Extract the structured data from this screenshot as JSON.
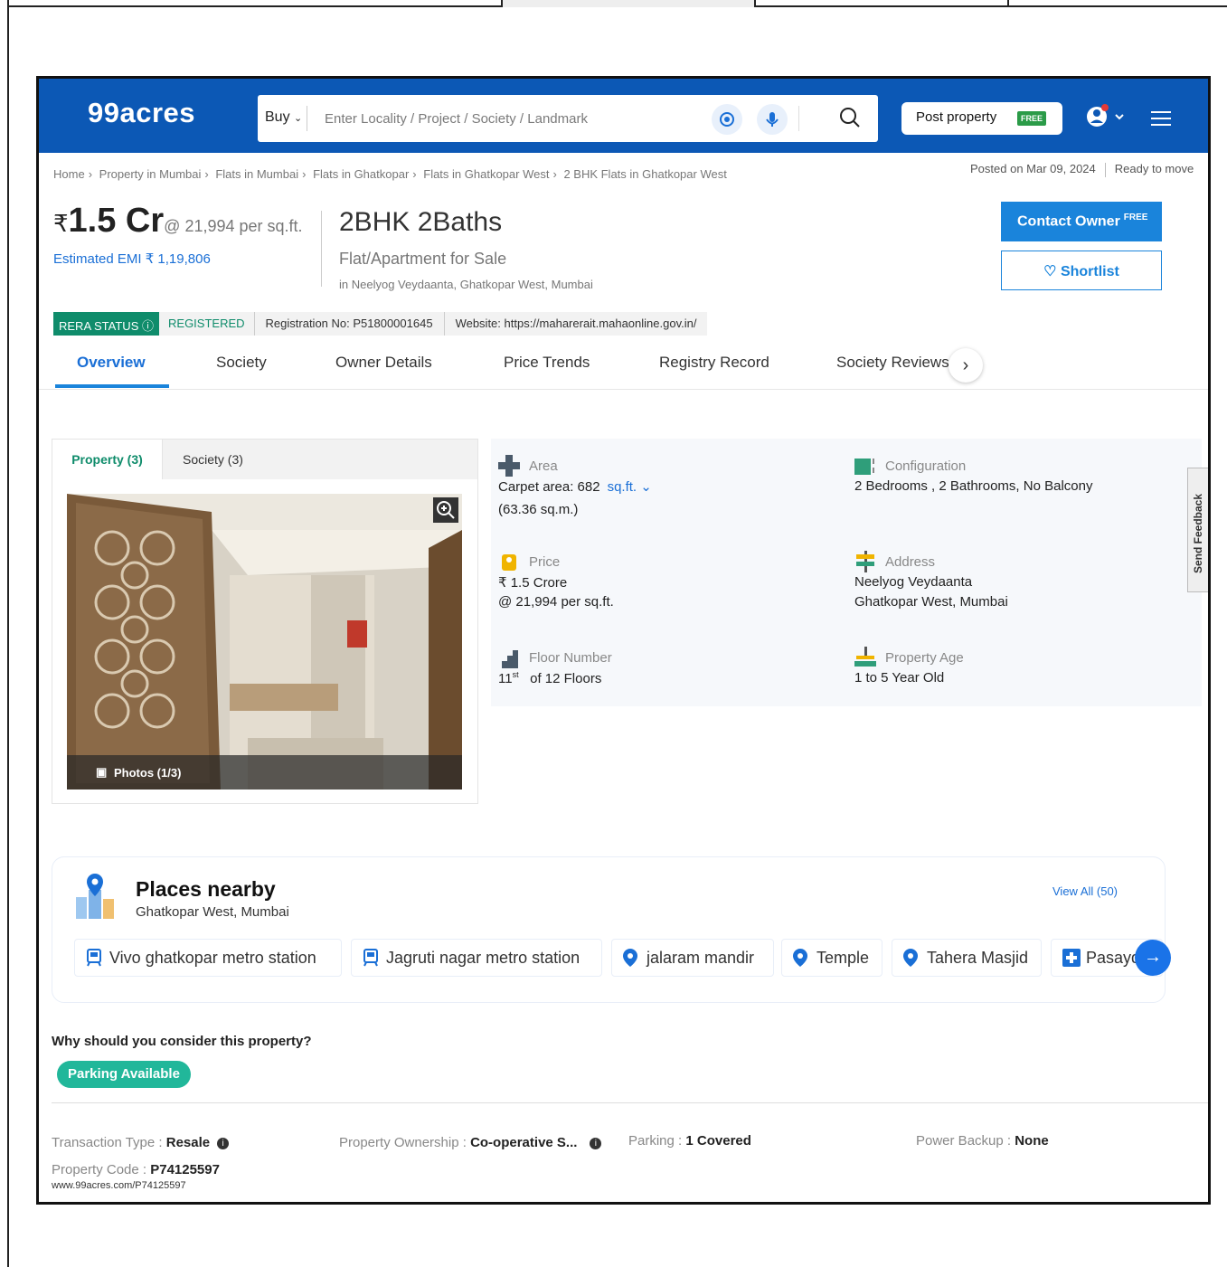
{
  "header": {
    "logo": "99acres",
    "buy_label": "Buy",
    "search_placeholder": "Enter Locality / Project / Society / Landmark",
    "post_property": "Post property",
    "free_badge": "FREE",
    "brand_color": "#0c58b5"
  },
  "breadcrumb": [
    "Home",
    "Property in Mumbai",
    "Flats in Mumbai",
    "Flats in Ghatkopar",
    "Flats in Ghatkopar West",
    "2 BHK Flats in Ghatkopar West"
  ],
  "posted": "Posted on Mar 09, 2024",
  "status": "Ready to move",
  "price": {
    "currency": "₹",
    "amount": "1.5 Cr",
    "per_sqft": "@ 21,994 per sq.ft.",
    "emi": "Estimated EMI ₹ 1,19,806"
  },
  "listing": {
    "title": "2BHK 2Baths",
    "type": "Flat/Apartment for Sale",
    "locality": "in Neelyog Veydaanta, Ghatkopar West, Mumbai"
  },
  "actions": {
    "contact_owner": "Contact Owner",
    "contact_free": "FREE",
    "shortlist": "Shortlist"
  },
  "rera": {
    "status_label": "RERA STATUS",
    "registered": "REGISTERED",
    "registration": "Registration No: P51800001645",
    "website": "Website: https://maharerait.mahaonline.gov.in/"
  },
  "tabs": [
    "Overview",
    "Society",
    "Owner Details",
    "Price Trends",
    "Registry Record",
    "Society Reviews"
  ],
  "photos": {
    "tab_property": "Property (3)",
    "tab_society": "Society (3)",
    "caption": "Photos (1/3)"
  },
  "details": {
    "area_label": "Area",
    "area_value": "Carpet area: 682",
    "area_unit": "sq.ft.",
    "area_sqm": "(63.36 sq.m.)",
    "config_label": "Configuration",
    "config_value": "2 Bedrooms , 2 Bathrooms, No Balcony",
    "price_label": "Price",
    "price_value": "₹ 1.5 Crore",
    "price_per": "@ 21,994 per sq.ft.",
    "address_label": "Address",
    "address_line1": "Neelyog Veydaanta",
    "address_line2": "Ghatkopar West, Mumbai",
    "floor_label": "Floor Number",
    "floor_num": "11",
    "floor_sup": "st",
    "floor_of": "of 12 Floors",
    "age_label": "Property Age",
    "age_value": "1 to 5 Year Old"
  },
  "feedback": "Send Feedback",
  "places": {
    "title": "Places nearby",
    "subtitle": "Ghatkopar West, Mumbai",
    "view_all": "View All (50)",
    "chips": [
      "Vivo ghatkopar metro station",
      "Jagruti nagar metro station",
      "jalaram mandir",
      "Temple",
      "Tahera Masjid",
      "Pasayda"
    ]
  },
  "why": {
    "question": "Why should you consider this property?",
    "pill": "Parking Available"
  },
  "meta": {
    "transaction_label": "Transaction Type : ",
    "transaction_value": "Resale",
    "ownership_label": "Property Ownership : ",
    "ownership_value": "Co-operative S...",
    "parking_label": "Parking : ",
    "parking_value": "1 Covered",
    "backup_label": "Power Backup : ",
    "backup_value": "None",
    "code_label": "Property Code : ",
    "code_value": "P74125597",
    "url": "www.99acres.com/P74125597"
  }
}
